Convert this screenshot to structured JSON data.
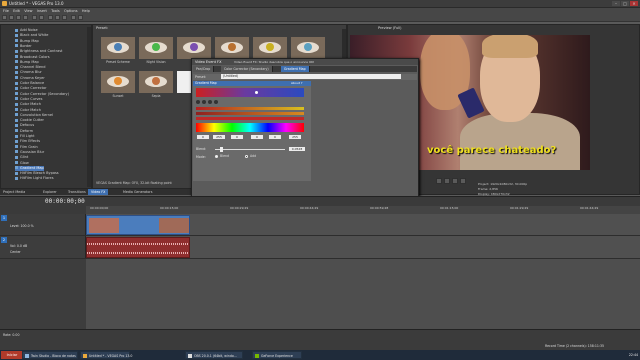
{
  "app": {
    "title": "Untitled * - VEGAS Pro 13.0",
    "window_controls": [
      "–",
      "□",
      "✕"
    ]
  },
  "menu": [
    "File",
    "Edit",
    "View",
    "Insert",
    "Tools",
    "Options",
    "Help"
  ],
  "explorer": {
    "items": [
      "Add Noise",
      "Black and White",
      "Bump Map",
      "Border",
      "Brightness and Contrast",
      "Broadcast Colors",
      "Bump Map",
      "Channel Blend",
      "Chroma Blur",
      "Chroma Keyer",
      "Color Balance",
      "Color Corrector",
      "Color Corrector (Secondary)",
      "Color Curves",
      "Color Match",
      "Color Match",
      "Convolution Kernel",
      "Cookie Cutter",
      "Defocus",
      "Deform",
      "Fill Light",
      "Film Effects",
      "Film Grain",
      "Gaussian Blur",
      "Glint",
      "Glow",
      "Gradient Map",
      "HitFilm Bleach Bypass",
      "HitFilm Light Flares"
    ],
    "selected_index": 26
  },
  "presets": {
    "header": "Preset:",
    "row1": [
      "Preset Scheme",
      "Night Vision",
      "",
      "",
      "",
      ""
    ],
    "row2": [
      "Sunset",
      "Sepia",
      ""
    ],
    "description": "VEGAS Gradient Map: OFX, 32-bit floating point",
    "iris_colors": [
      "#4a7fb5",
      "#49b84a",
      "#7b4fb0",
      "#b87030",
      "#c9b020",
      "#5aa0c0",
      "#e08a30",
      "#c07040",
      "#ffffff"
    ]
  },
  "bottom_tabs": [
    "Project Media",
    "Explorer",
    "Transitions",
    "Video FX",
    "Media Generators"
  ],
  "bottom_tab_active": 3,
  "fx_dialog": {
    "title": "Video Event FX",
    "subtitle": "Video Event FX:  Studio descobre que o announce OK!",
    "chain": [
      "Pan/Crop",
      "Color Corrector (Secondary)",
      "Gradient Map"
    ],
    "chain_active": 2,
    "preset_label": "Preset:",
    "preset_value": "(Untitled)",
    "plugin_title": "Gradient Map",
    "plugin_about": "About ?",
    "numbers": [
      "0",
      "255",
      "0",
      "0",
      "0",
      "255"
    ],
    "blend_label": "Blend:",
    "blend_value": "0.0528",
    "mode_label": "Mode:",
    "mode_options": [
      "Blend",
      "Add"
    ],
    "mode_selected": "Add",
    "animate_label": "Animate"
  },
  "preview": {
    "title": "Preview (Full)",
    "subtitle": "você parece chateado?",
    "project_info": "Project: 1920x1080x32, 30.000p",
    "frame_info": "Frame: 2,856",
    "display_info": "Display: 480x270x32",
    "accent": "#f0e020"
  },
  "timeline": {
    "timecode": "00:00:00;00",
    "ruler": [
      "00:00:00;00",
      "00:00:15;00",
      "00:00:29;29",
      "00:00:44;29",
      "00:00:59;28",
      "00:01:15;00",
      "00:01:29;29",
      "00:01:44;29"
    ],
    "tracks": [
      {
        "num": "1",
        "label": "Level: 100.0 %",
        "kind": "video"
      },
      {
        "num": "2",
        "label": "Vol: 0.0 dB",
        "kind": "audio",
        "pan": "Center"
      }
    ]
  },
  "status": {
    "rate": "Rate: 0.00",
    "record_time": "Record Time (2 channels): 158:11:35"
  },
  "taskbar": {
    "start": "Iniciar",
    "tasks": [
      "Untitled * - VEGAS Pro 13.0",
      "Twin Studio - Bloco de notas",
      "OBS 20.0.1 (64bit, windo...",
      "GeForce Experience"
    ],
    "clock": "22:44"
  }
}
